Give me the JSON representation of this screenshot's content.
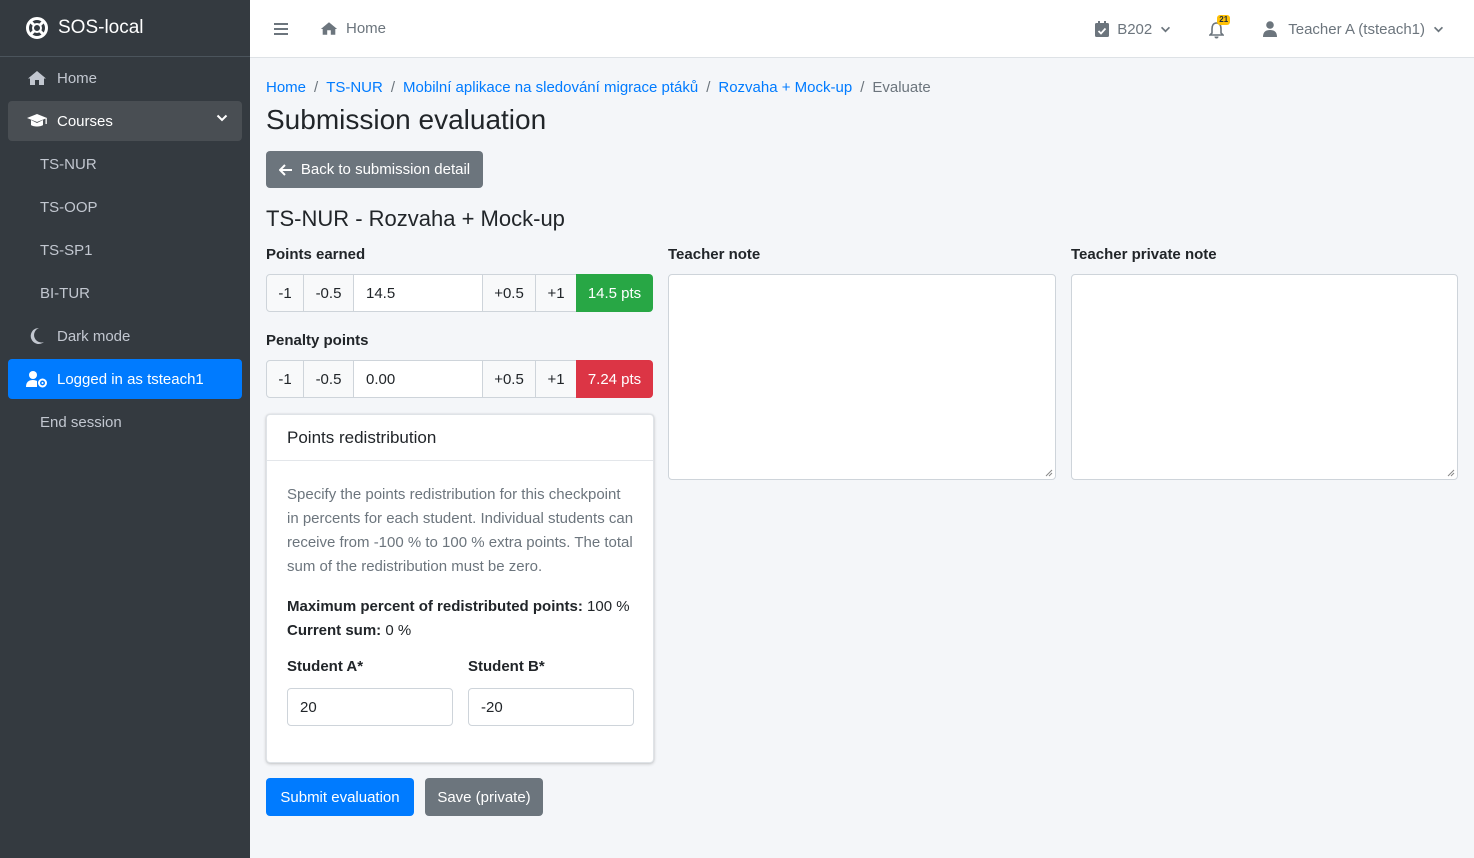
{
  "app": {
    "title": "SOS-local"
  },
  "sidebar": {
    "items": [
      {
        "label": "Home",
        "icon": "home-icon"
      },
      {
        "label": "Courses",
        "icon": "graduation-cap-icon"
      },
      {
        "label": "Dark mode",
        "icon": "moon-icon"
      },
      {
        "label": "Logged in as tsteach1",
        "icon": "user-cog-icon"
      },
      {
        "label": "End session"
      }
    ],
    "courses": [
      "TS-NUR",
      "TS-OOP",
      "TS-SP1",
      "BI-TUR"
    ]
  },
  "topbar": {
    "home_label": "Home",
    "room_label": "B202",
    "notification_count": "21",
    "user_label": "Teacher A (tsteach1)"
  },
  "breadcrumb": [
    "Home",
    "TS-NUR",
    "Mobilní aplikace na sledování migrace ptáků",
    "Rozvaha + Mock-up",
    "Evaluate"
  ],
  "page": {
    "title": "Submission evaluation",
    "back_label": "Back to submission detail",
    "subtitle": "TS-NUR - Rozvaha + Mock-up"
  },
  "points": {
    "label": "Points earned",
    "minus1": "-1",
    "minus05": "-0.5",
    "value": "14.5",
    "plus05": "+0.5",
    "plus1": "+1",
    "badge": "14.5 pts"
  },
  "penalty": {
    "label": "Penalty points",
    "minus1": "-1",
    "minus05": "-0.5",
    "value": "0.00",
    "plus05": "+0.5",
    "plus1": "+1",
    "badge": "7.24 pts"
  },
  "redistribution": {
    "title": "Points redistribution",
    "description": "Specify the points redistribution for this checkpoint in percents for each student. Individual students can receive from -100 % to 100 % extra points. The total sum of the redistribution must be zero.",
    "max_label": "Maximum percent of redistributed points:",
    "max_value": "100 %",
    "sum_label": "Current sum:",
    "sum_value": "0 %",
    "students": [
      {
        "name": "Student A*",
        "value": "20"
      },
      {
        "name": "Student B*",
        "value": "-20"
      }
    ]
  },
  "notes": {
    "teacher_label": "Teacher note",
    "private_label": "Teacher private note"
  },
  "actions": {
    "submit_label": "Submit evaluation",
    "save_label": "Save (private)"
  },
  "colors": {
    "primary": "#007bff",
    "secondary": "#6c757d",
    "success": "#28a745",
    "danger": "#dc3545",
    "sidebar": "#343a40"
  }
}
